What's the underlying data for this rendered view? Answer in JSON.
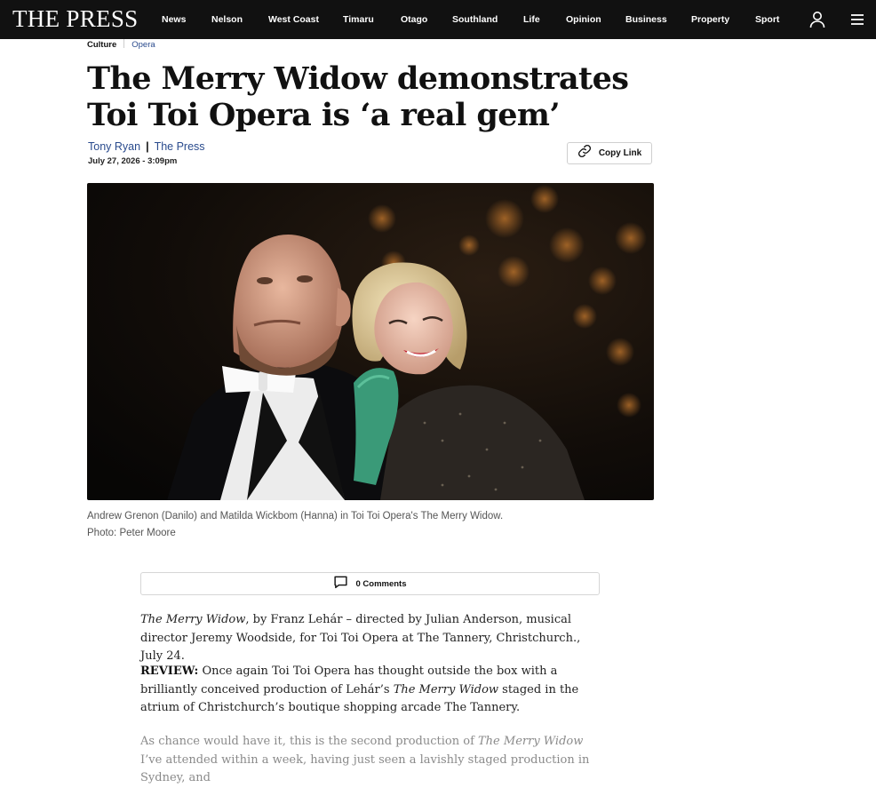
{
  "site": {
    "logo": "THE PRESS"
  },
  "nav": {
    "items": [
      "News",
      "Nelson",
      "West Coast",
      "Timaru",
      "Otago",
      "Southland",
      "Life",
      "Opinion",
      "Business",
      "Property",
      "Sport"
    ],
    "icons": [
      "user-icon",
      "menu-icon"
    ]
  },
  "breadcrumb": {
    "section": "Culture",
    "subsection": "Opera"
  },
  "article": {
    "headline": "The Merry Widow demonstrates Toi Toi Opera is ‘a real gem’",
    "author": "Tony Ryan",
    "separator": "|",
    "publication": "The Press",
    "date": "July 27, 2026 - 3:09pm",
    "copy_link_label": "Copy Link",
    "caption_line1": "Andrew Grenon (Danilo) and Matilda Wickbom (Hanna) in Toi Toi Opera's The Merry Widow.",
    "caption_line2": "Photo: Peter Moore",
    "comments_label": "0 Comments",
    "p1": {
      "title": "The Merry Widow",
      "rest": ", by Franz Lehár – directed by Julian Anderson, musical director Jeremy Woodside, for Toi Toi Opera at The Tannery, Christchurch., July 24."
    },
    "p2": {
      "lead": "REVIEW:",
      "a": " Once again Toi Toi Opera has thought outside the box with a brilliantly conceived production of Lehár’s ",
      "title": "The Merry Widow",
      "b": " staged in the atrium of Christchurch’s boutique shopping arcade The Tannery."
    },
    "p3": {
      "a": "As chance would have it, this is the second production of ",
      "title": "The Merry Widow",
      "b": " I’ve attended within a week, having just seen a lavishly staged production in Sydney, and"
    }
  },
  "colors": {
    "topbar": "#111111",
    "link": "#2a4b8d",
    "caption": "#555555"
  }
}
